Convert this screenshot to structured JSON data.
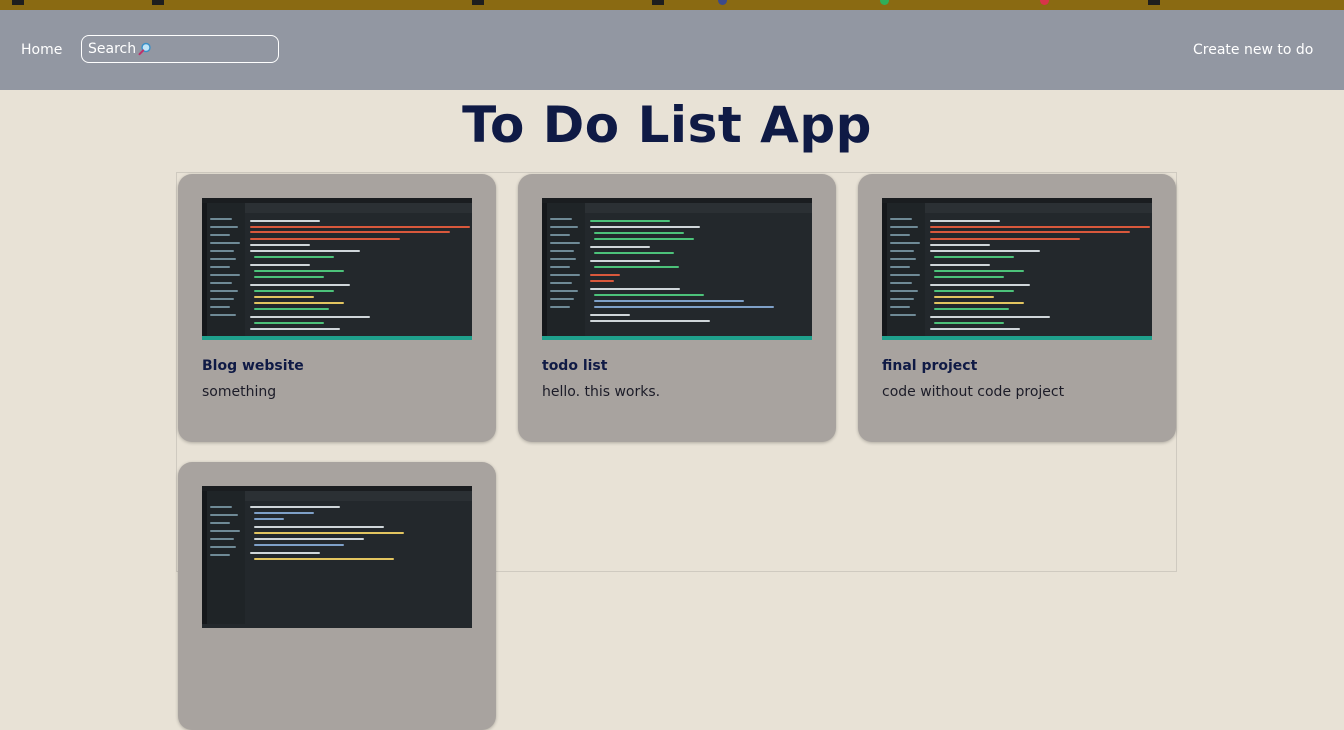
{
  "nav": {
    "home_label": "Home",
    "search_placeholder": "Search",
    "create_label": "Create new to do"
  },
  "page": {
    "title": "To Do List App"
  },
  "todos": [
    {
      "title": "Blog website",
      "description": "something",
      "thumbnail": "code-editor-screenshot"
    },
    {
      "title": "todo list",
      "description": "hello. this works.",
      "thumbnail": "code-editor-screenshot"
    },
    {
      "title": "final project",
      "description": "code without code project",
      "thumbnail": "code-editor-screenshot"
    },
    {
      "title": "",
      "description": "",
      "thumbnail": "code-editor-screenshot"
    }
  ],
  "colors": {
    "navbar": "#9297a2",
    "background": "#e8e2d6",
    "card": "#a8a39f",
    "title": "#0f1a45"
  },
  "icons": {
    "search": "magnifier-icon"
  }
}
